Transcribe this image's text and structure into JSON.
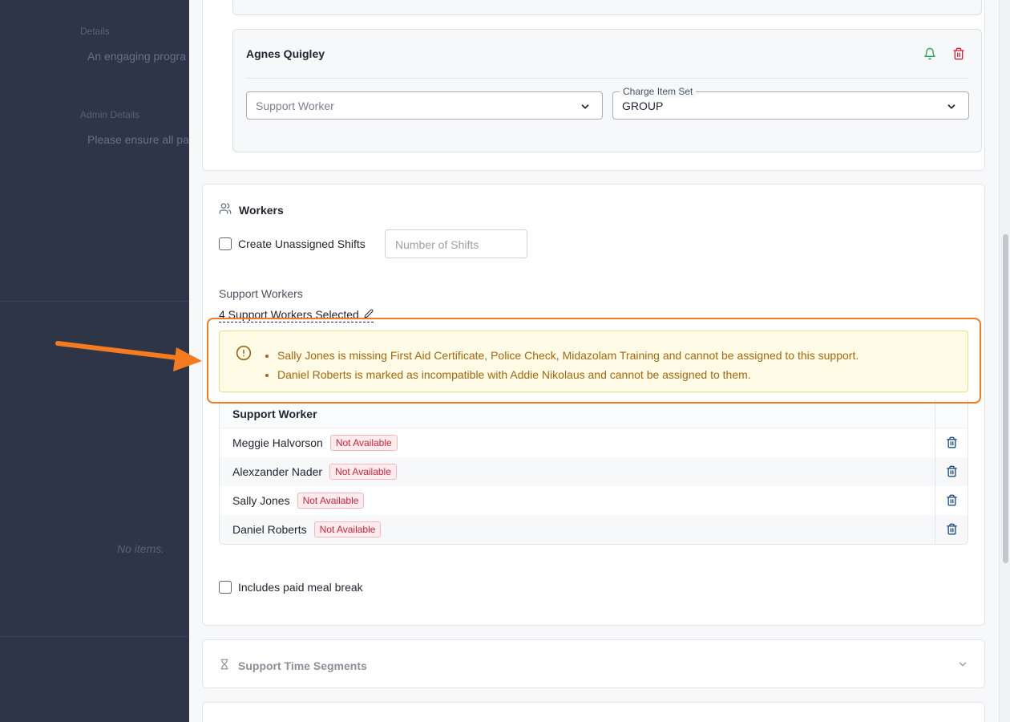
{
  "background": {
    "details_label": "Details",
    "details_text": "An engaging progra",
    "admin_label": "Admin Details",
    "admin_text": "Please ensure all pa",
    "empty_text": "No items."
  },
  "participant": {
    "name": "Agnes Quigley",
    "support_worker_placeholder": "Support Worker",
    "charge_item_label": "Charge Item Set",
    "charge_item_value": "GROUP"
  },
  "workers": {
    "title": "Workers",
    "create_unassigned_label": "Create Unassigned Shifts",
    "shifts_placeholder": "Number of Shifts",
    "support_workers_label": "Support Workers",
    "selected_text": "4 Support Workers Selected",
    "warnings": [
      "Sally Jones is missing First Aid Certificate, Police Check, Midazolam Training and cannot be assigned to this support.",
      "Daniel Roberts is marked as incompatible with Addie Nikolaus and cannot be assigned to them."
    ],
    "table_header": "Support Worker",
    "rows": [
      {
        "name": "Meggie Halvorson",
        "status": "Not Available"
      },
      {
        "name": "Alexzander Nader",
        "status": "Not Available"
      },
      {
        "name": "Sally Jones",
        "status": "Not Available"
      },
      {
        "name": "Daniel Roberts",
        "status": "Not Available"
      }
    ],
    "meal_break_label": "Includes paid meal break"
  },
  "segments": {
    "title": "Support Time Segments"
  },
  "colors": {
    "warning_bg": "#fefce6",
    "warning_text": "#a8660d",
    "badge_red": "#d0233c",
    "annotation_orange": "#f47b1f"
  }
}
